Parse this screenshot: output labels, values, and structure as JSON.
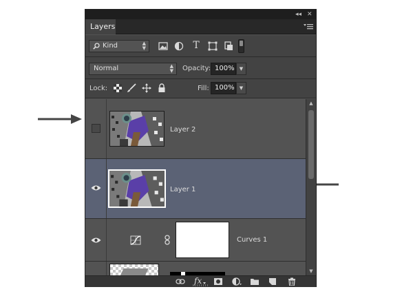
{
  "panel": {
    "title_controls": {
      "collapse": "◂◂",
      "close": "✕"
    },
    "tab_label": "Layers"
  },
  "filter_row": {
    "kind_label": "Kind",
    "filter_buttons": [
      "image-filter-icon",
      "adjustment-filter-icon",
      "type-filter-icon",
      "shape-filter-icon",
      "smart-object-filter-icon",
      "filter-toggle-icon"
    ],
    "type_glyph": "T"
  },
  "blend_row": {
    "mode": "Normal",
    "opacity_label": "Opacity:",
    "opacity_value": "100%"
  },
  "lock_row": {
    "lock_label": "Lock:",
    "fill_label": "Fill:",
    "fill_value": "100%"
  },
  "layers": [
    {
      "name": "Layer 2",
      "visible": false,
      "selected": false
    },
    {
      "name": "Layer 1",
      "visible": true,
      "selected": true
    },
    {
      "name": "Curves 1",
      "visible": true,
      "selected": false,
      "adjustment": true
    }
  ],
  "bottom_bar": {
    "fx_label": "fx",
    "buttons": [
      "link-icon",
      "fx-icon",
      "mask-icon",
      "new-adjustment-icon",
      "folder-icon",
      "new-layer-icon",
      "trash-icon"
    ]
  },
  "colors": {
    "panel_bg": "#535353",
    "selected_layer": "#5b6275",
    "annotation_arrow": "#4a4a4a"
  }
}
